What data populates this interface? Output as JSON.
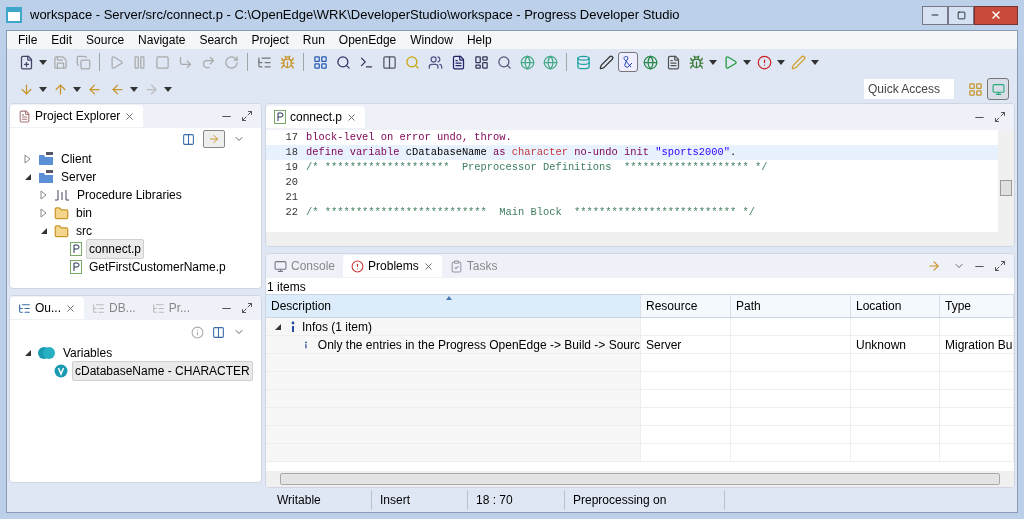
{
  "window": {
    "title": "workspace - Server/src/connect.p - C:\\OpenEdge\\WRK\\DeveloperStudio\\workspace - Progress Developer Studio"
  },
  "menu": [
    "File",
    "Edit",
    "Source",
    "Navigate",
    "Search",
    "Project",
    "Run",
    "OpenEdge",
    "Window",
    "Help"
  ],
  "quick_access": {
    "placeholder": "Quick Access"
  },
  "project_explorer": {
    "tabs": [
      {
        "label": "Project Explorer",
        "selected": true
      }
    ],
    "tree": [
      {
        "label": "Client",
        "kind": "project",
        "expanded": false,
        "selected": false
      },
      {
        "label": "Server",
        "kind": "project",
        "expanded": true,
        "selected": false,
        "children": [
          {
            "label": "Procedure Libraries",
            "kind": "library",
            "expanded": false,
            "selected": false
          },
          {
            "label": "bin",
            "kind": "folder",
            "expanded": false,
            "selected": false
          },
          {
            "label": "src",
            "kind": "folder",
            "expanded": true,
            "selected": false,
            "children": [
              {
                "label": "connect.p",
                "kind": "file",
                "selected": true
              },
              {
                "label": "GetFirstCustomerName.p",
                "kind": "file",
                "selected": false
              }
            ]
          }
        ]
      }
    ]
  },
  "outline": {
    "tabs": [
      {
        "label": "Ou...",
        "selected": true
      },
      {
        "label": "DB...",
        "selected": false
      },
      {
        "label": "Pr...",
        "selected": false
      }
    ],
    "tree": [
      {
        "label": "Variables",
        "kind": "group",
        "expanded": true,
        "selected": false,
        "children": [
          {
            "label": "cDatabaseName - CHARACTER",
            "kind": "variable",
            "selected": true
          }
        ]
      }
    ]
  },
  "editor": {
    "tabs": [
      {
        "label": "connect.p",
        "selected": true
      }
    ],
    "lines": [
      {
        "number": "17",
        "current": false,
        "tokens": [
          {
            "kind": "keyword",
            "text": "block-level on error undo, throw."
          }
        ]
      },
      {
        "number": "18",
        "current": true,
        "tokens": [
          {
            "kind": "keyword",
            "text": "define variable"
          },
          {
            "kind": "plain",
            "text": " cDatabaseName "
          },
          {
            "kind": "keyword",
            "text": "as "
          },
          {
            "kind": "type",
            "text": "character"
          },
          {
            "kind": "keyword",
            "text": " no-undo init "
          },
          {
            "kind": "string",
            "text": "\"sports2000\""
          },
          {
            "kind": "plain",
            "text": "."
          }
        ]
      },
      {
        "number": "19",
        "current": false,
        "tokens": [
          {
            "kind": "comment",
            "text": "/* ********************  Preprocessor Definitions  ******************** */"
          }
        ]
      },
      {
        "number": "20",
        "current": false
      },
      {
        "number": "21",
        "current": false
      },
      {
        "number": "22",
        "current": false,
        "tokens": [
          {
            "kind": "comment",
            "text": "/* **************************  Main Block  ************************** */"
          }
        ]
      }
    ]
  },
  "bottom": {
    "tabs": [
      {
        "label": "Console",
        "selected": false
      },
      {
        "label": "Problems",
        "selected": true
      },
      {
        "label": "Tasks",
        "selected": false
      }
    ],
    "count": "1 items",
    "columns": [
      {
        "label": "Description",
        "sorted": true
      },
      {
        "label": "Resource",
        "sorted": false
      },
      {
        "label": "Path",
        "sorted": false
      },
      {
        "label": "Location",
        "sorted": false
      },
      {
        "label": "Type",
        "sorted": false
      }
    ],
    "groups": [
      {
        "label": "Infos (1 item)",
        "expanded": true,
        "rows": [
          {
            "description": "Only the entries in the Progress OpenEdge -> Build -> Sourc",
            "resource": "Server",
            "location": "Unknown",
            "type": "Migration Bu"
          }
        ]
      }
    ]
  },
  "status_bar": [
    "Writable",
    "Insert",
    "18 : 70",
    "Preprocessing on"
  ]
}
